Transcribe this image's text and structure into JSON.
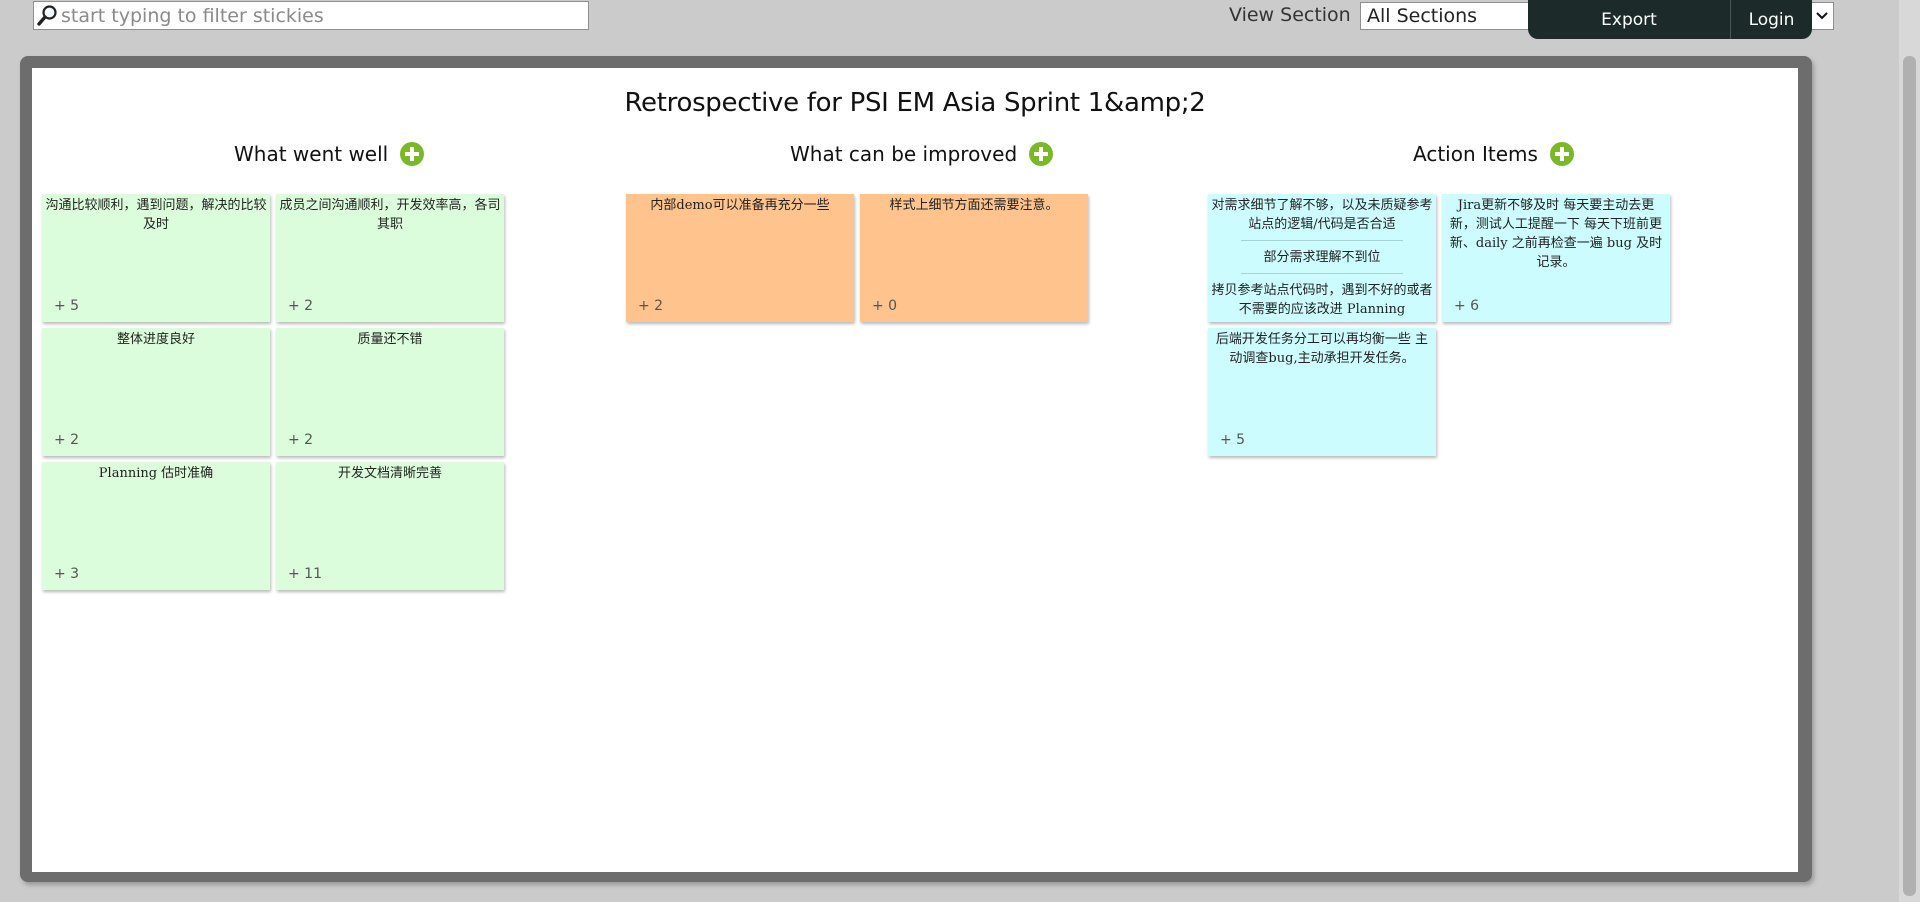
{
  "search": {
    "placeholder": "start typing to filter stickies",
    "value": ""
  },
  "view_section": {
    "label": "View Section",
    "selected": "All Sections"
  },
  "toolbar": {
    "export_label": "Export",
    "login_label": "Login"
  },
  "board": {
    "title": "Retrospective for PSI EM Asia Sprint 1&amp;2",
    "columns": [
      {
        "title": "What went well",
        "color": "#dbfddb",
        "stickies": [
          {
            "text": "沟通比较顺利，遇到问题，解决的比较及时",
            "votes": "+ 5"
          },
          {
            "text": "成员之间沟通顺利，开发效率高，各司其职",
            "votes": "+ 2"
          },
          {
            "text": "整体进度良好",
            "votes": "+ 2"
          },
          {
            "text": "质量还不错",
            "votes": "+ 2"
          },
          {
            "text": "Planning 估时准确",
            "votes": "+ 3"
          },
          {
            "text": "开发文档清晰完善",
            "votes": "+ 11"
          }
        ]
      },
      {
        "title": "What can be improved",
        "color": "#ffc38d",
        "stickies": [
          {
            "text": "内部demo可以准备再充分一些",
            "votes": "+ 2"
          },
          {
            "text": "样式上细节方面还需要注意。",
            "votes": "+ 0"
          }
        ]
      },
      {
        "title": "Action Items",
        "color": "#ccfcfe",
        "stickies": [
          {
            "parts": [
              "对需求细节了解不够，以及未质疑参考站点的逻辑/代码是否合适",
              "部分需求理解不到位",
              "拷贝参考站点代码时，遇到不好的或者不需要的应该改进 Planning"
            ],
            "votes": ""
          },
          {
            "text": "Jira更新不够及时 每天要主动去更新，测试人工提醒一下 每天下班前更新、daily 之前再检查一遍 bug 及时记录。",
            "votes": "+ 6"
          },
          {
            "text": "后端开发任务分工可以再均衡一些 主动调查bug,主动承担开发任务。",
            "votes": "+ 5"
          }
        ]
      }
    ]
  }
}
